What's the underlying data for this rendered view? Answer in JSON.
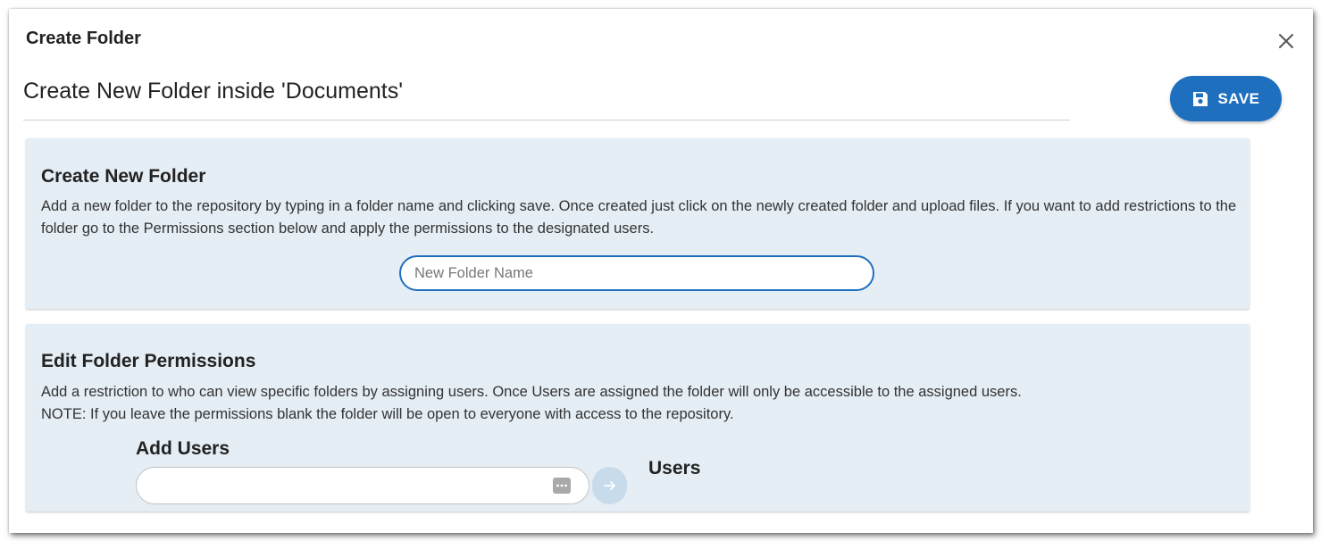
{
  "dialog": {
    "title": "Create Folder",
    "heading": "Create New Folder inside 'Documents'",
    "save_label": "SAVE"
  },
  "create_section": {
    "title": "Create New Folder",
    "description": "Add a new folder to the repository by typing in a folder name and clicking save. Once created just click on the newly created folder and upload files. If you want to add restrictions to the folder go to the Permissions section below and apply the permissions to the designated users.",
    "folder_name_value": "",
    "folder_name_placeholder": "New Folder Name"
  },
  "permissions_section": {
    "title": "Edit Folder Permissions",
    "description": "Add a restriction to who can view specific folders by assigning users. Once Users are assigned the folder will only be accessible to the assigned users.",
    "note": "NOTE: If you leave the permissions blank the folder will be open to everyone with access to the repository.",
    "add_users_label": "Add Users",
    "add_users_value": "",
    "users_label": "Users"
  },
  "icons": {
    "close": "close-icon",
    "save": "floppy-disk-icon",
    "picker": "ellipsis-box-icon",
    "add": "arrow-right-icon"
  },
  "colors": {
    "accent": "#1f6fbf",
    "panel_background": "#e5eef5",
    "add_button_disabled": "#c8dbea"
  }
}
